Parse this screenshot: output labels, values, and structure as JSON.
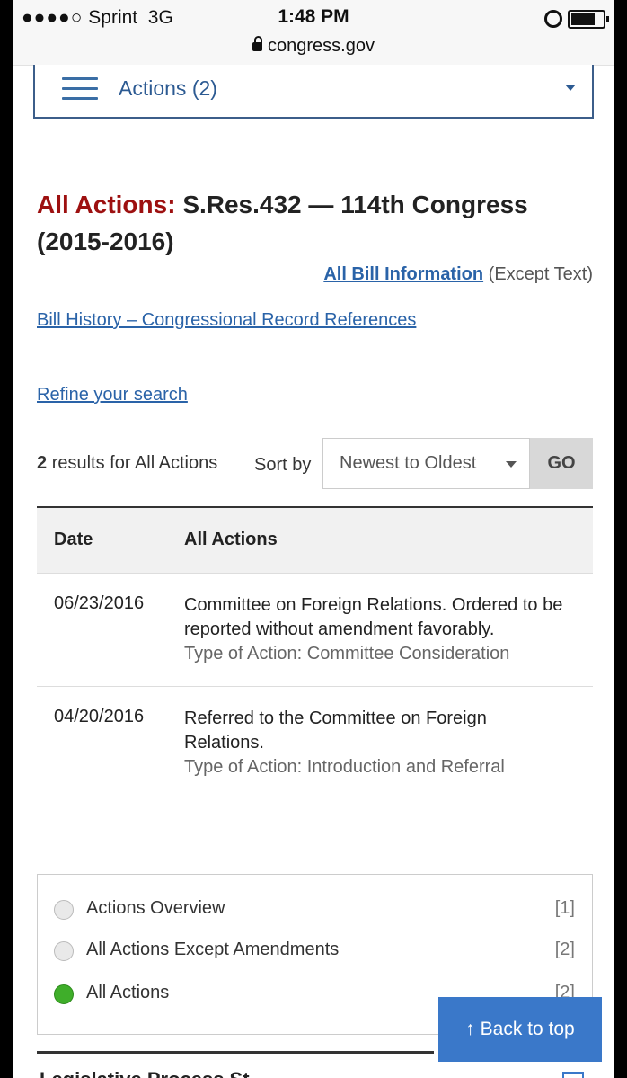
{
  "status_bar": {
    "carrier_signal": "●●●●○",
    "carrier": "Sprint",
    "network": "3G",
    "time": "1:48 PM",
    "url": "congress.gov",
    "icons": [
      "lock-icon",
      "alarm-icon",
      "battery-icon"
    ]
  },
  "actions_menu": {
    "label": "Actions (2)"
  },
  "page": {
    "title_prefix": "All Actions:",
    "title_main": "S.Res.432 — 114th Congress (2015-2016)",
    "all_bill_info_link": "All Bill Information",
    "all_bill_info_suffix": "(Except Text)",
    "history_link": "Bill History – Congressional Record References",
    "refine_link": "Refine your search"
  },
  "results": {
    "count": "2",
    "count_suffix": "results for All Actions",
    "sort_label": "Sort by",
    "sort_value": "Newest to Oldest",
    "go_label": "GO"
  },
  "table": {
    "headers": [
      "Date",
      "All Actions"
    ],
    "rows": [
      {
        "date": "06/23/2016",
        "action": "Committee on Foreign Relations. Ordered to be reported without amendment favorably.",
        "type": "Type of Action: Committee Consideration"
      },
      {
        "date": "04/20/2016",
        "action": "Referred to the Committee on Foreign Relations.",
        "type": "Type of Action: Introduction and Referral"
      }
    ]
  },
  "filters": [
    {
      "label": "Actions Overview",
      "count": "[1]",
      "checked": false
    },
    {
      "label": "All Actions Except Amendments",
      "count": "[2]",
      "checked": false
    },
    {
      "label": "All Actions",
      "count": "[2]",
      "checked": true
    }
  ],
  "back_to_top": "↑ Back to top",
  "next_section_partial": "Legislative Process St",
  "colors": {
    "title_prefix": "#9d1010",
    "link": "#2a63a8",
    "accent_button": "#3a78c9",
    "checked_radio": "#3fae2a"
  }
}
